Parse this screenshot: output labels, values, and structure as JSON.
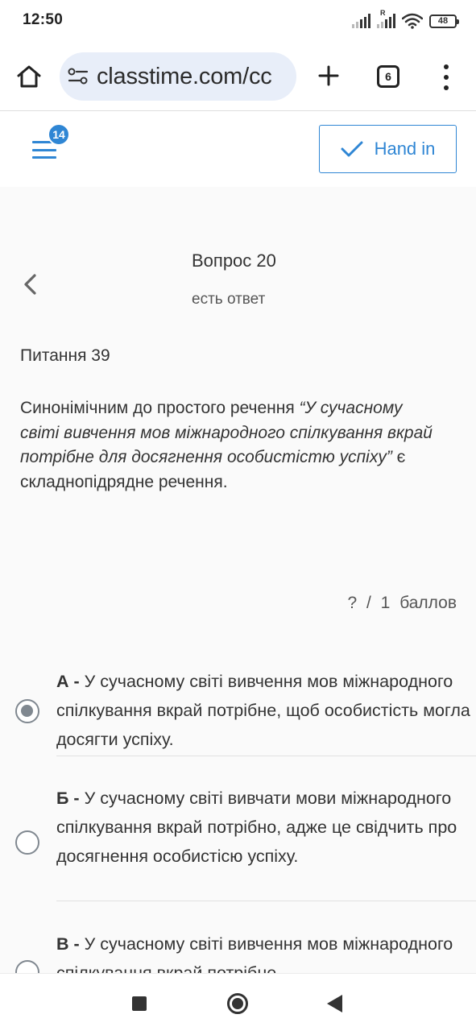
{
  "status_bar": {
    "time": "12:50",
    "roaming_indicator": "R",
    "battery_level": "48",
    "icons": [
      "signal-icon",
      "signal-roaming-icon",
      "wifi-icon",
      "battery-icon"
    ]
  },
  "browser": {
    "url": "classtime.com/cc",
    "tab_count": "6",
    "icons": [
      "home-icon",
      "site-settings-icon",
      "plus-icon",
      "tabs-icon",
      "more-vert-icon"
    ]
  },
  "header": {
    "notification_count": "14",
    "hand_in_label": "Hand in",
    "accent_color": "#2f86d4"
  },
  "question": {
    "title": "Вопрос 20",
    "status": "есть ответ",
    "number_label": "Питання 39",
    "text_prefix": "Синонімічним до простого речення ",
    "text_quote": "“У сучасному світі вивчення мов міжнародного спілкування вкрай потрібне для досягнення особистістю успіху”",
    "text_suffix": " є складнопідрядне речення.",
    "score": "? / 1 баллов"
  },
  "options": [
    {
      "letter": "А -",
      "text": " У сучасному світі вивчення мов міжнародного спілкування вкрай потрібне, щоб особистість могла досягти успіху.",
      "selected": true
    },
    {
      "letter": "Б -",
      "text": " У сучасному світі вивчати мови міжнародного спілкування вкрай потрібно, адже це свідчить про досягнення особистісю успіху.",
      "selected": false
    },
    {
      "letter": "В -",
      "text": " У сучасному світі вивчення мов міжнародного спілкування вкрай потрібне",
      "selected": false
    }
  ],
  "nav_bar": {
    "icons": [
      "recents-icon",
      "home-circle-icon",
      "back-triangle-icon"
    ]
  }
}
